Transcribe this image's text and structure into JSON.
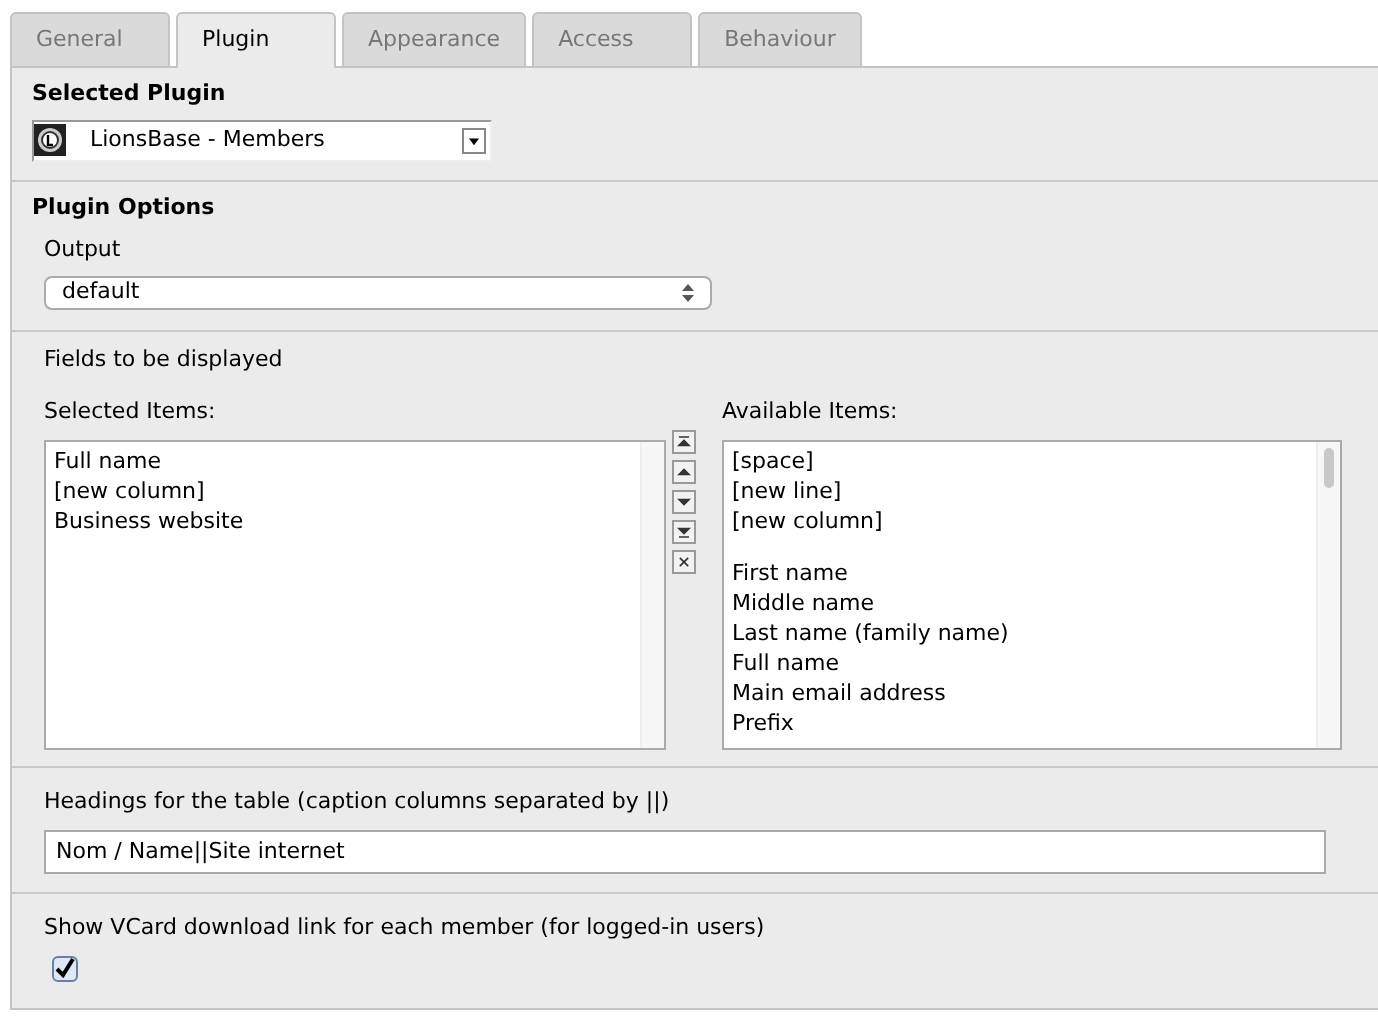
{
  "tabs": [
    {
      "label": "General",
      "selected": false
    },
    {
      "label": "Plugin",
      "selected": true
    },
    {
      "label": "Appearance",
      "selected": false
    },
    {
      "label": "Access",
      "selected": false
    },
    {
      "label": "Behaviour",
      "selected": false
    }
  ],
  "selected_plugin": {
    "title": "Selected Plugin",
    "value": "LionsBase - Members"
  },
  "plugin_options": {
    "title": "Plugin Options",
    "output": {
      "label": "Output",
      "value": "default"
    }
  },
  "fields": {
    "title": "Fields to be displayed",
    "selected_label": "Selected Items:",
    "selected_items": [
      "Full name",
      "[new column]",
      "Business website"
    ],
    "available_label": "Available Items:",
    "available_groups": [
      [
        "[space]",
        "[new line]",
        "[new column]"
      ],
      [
        "First name",
        "Middle name",
        "Last name (family name)",
        "Full name",
        "Main email address",
        "Prefix"
      ]
    ]
  },
  "headings": {
    "label": "Headings for the table (caption columns separated by ||)",
    "value": "Nom / Name||Site internet"
  },
  "vcard": {
    "label": "Show VCard download link for each member (for logged-in users)",
    "checked": true
  }
}
